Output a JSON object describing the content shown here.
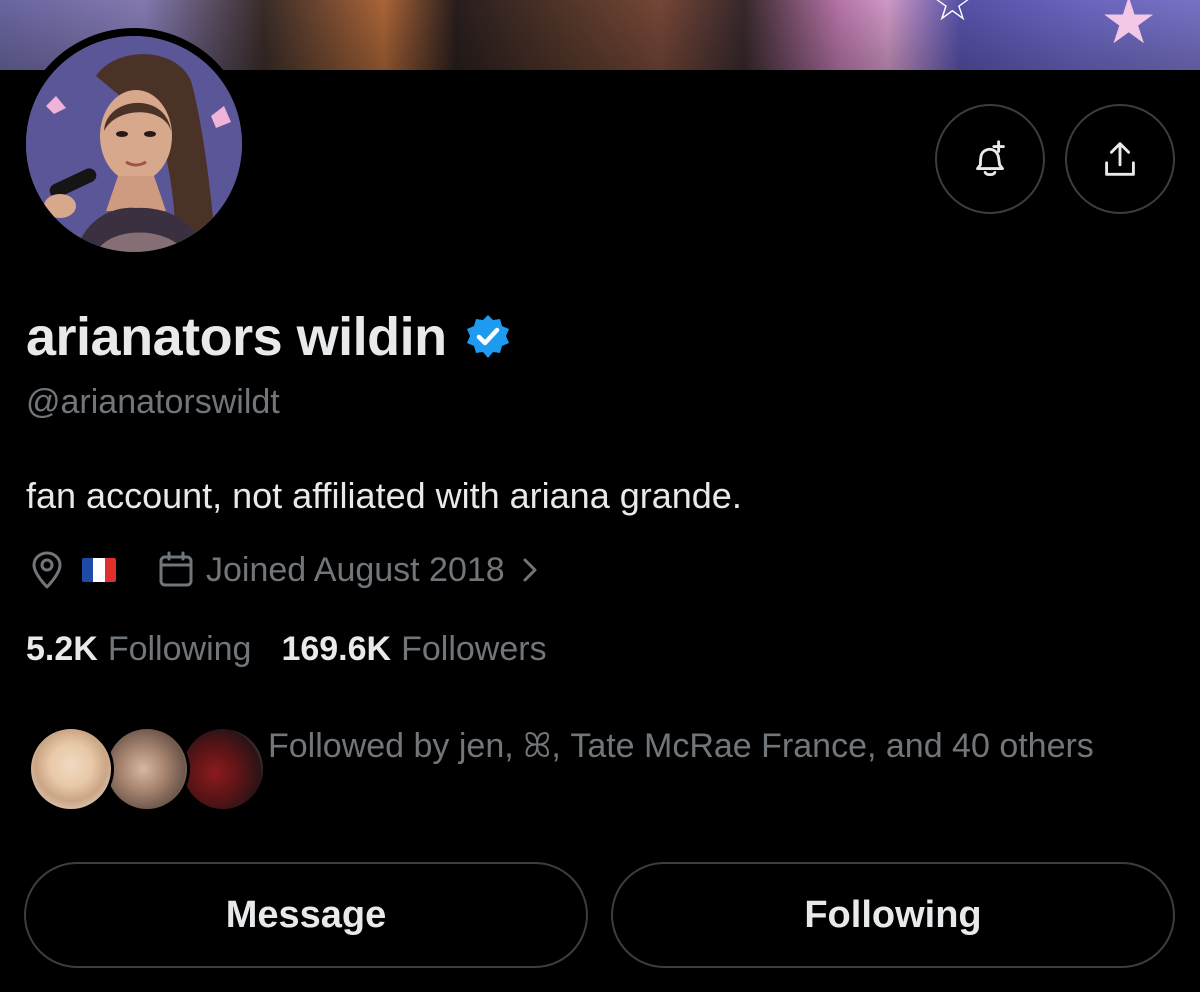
{
  "profile": {
    "display_name": "arianators wildin",
    "handle": "@arianatorswildt",
    "bio": "fan account, not affiliated with ariana grande.",
    "verified": true,
    "verified_color": "#1d9bf0"
  },
  "meta": {
    "location_icon": "location-pin-icon",
    "location_flag": "French flag",
    "flag_colors": [
      "#1f4aa8",
      "#ffffff",
      "#e0302e"
    ],
    "joined": "Joined August 2018",
    "joined_icon": "calendar-icon"
  },
  "stats": {
    "following_count": "5.2K",
    "following_label": "Following",
    "followers_count": "169.6K",
    "followers_label": "Followers"
  },
  "followed_by": {
    "text": "Followed by jen, ꕤ, Tate McRae France, and 40 others"
  },
  "actions": {
    "notify_icon": "bell-plus-icon",
    "share_icon": "share-icon",
    "message_label": "Message",
    "following_label": "Following"
  },
  "colors": {
    "background": "#000000",
    "primary_text": "#e7e9ea",
    "secondary_text": "#71767b",
    "border": "#3a3d42"
  }
}
